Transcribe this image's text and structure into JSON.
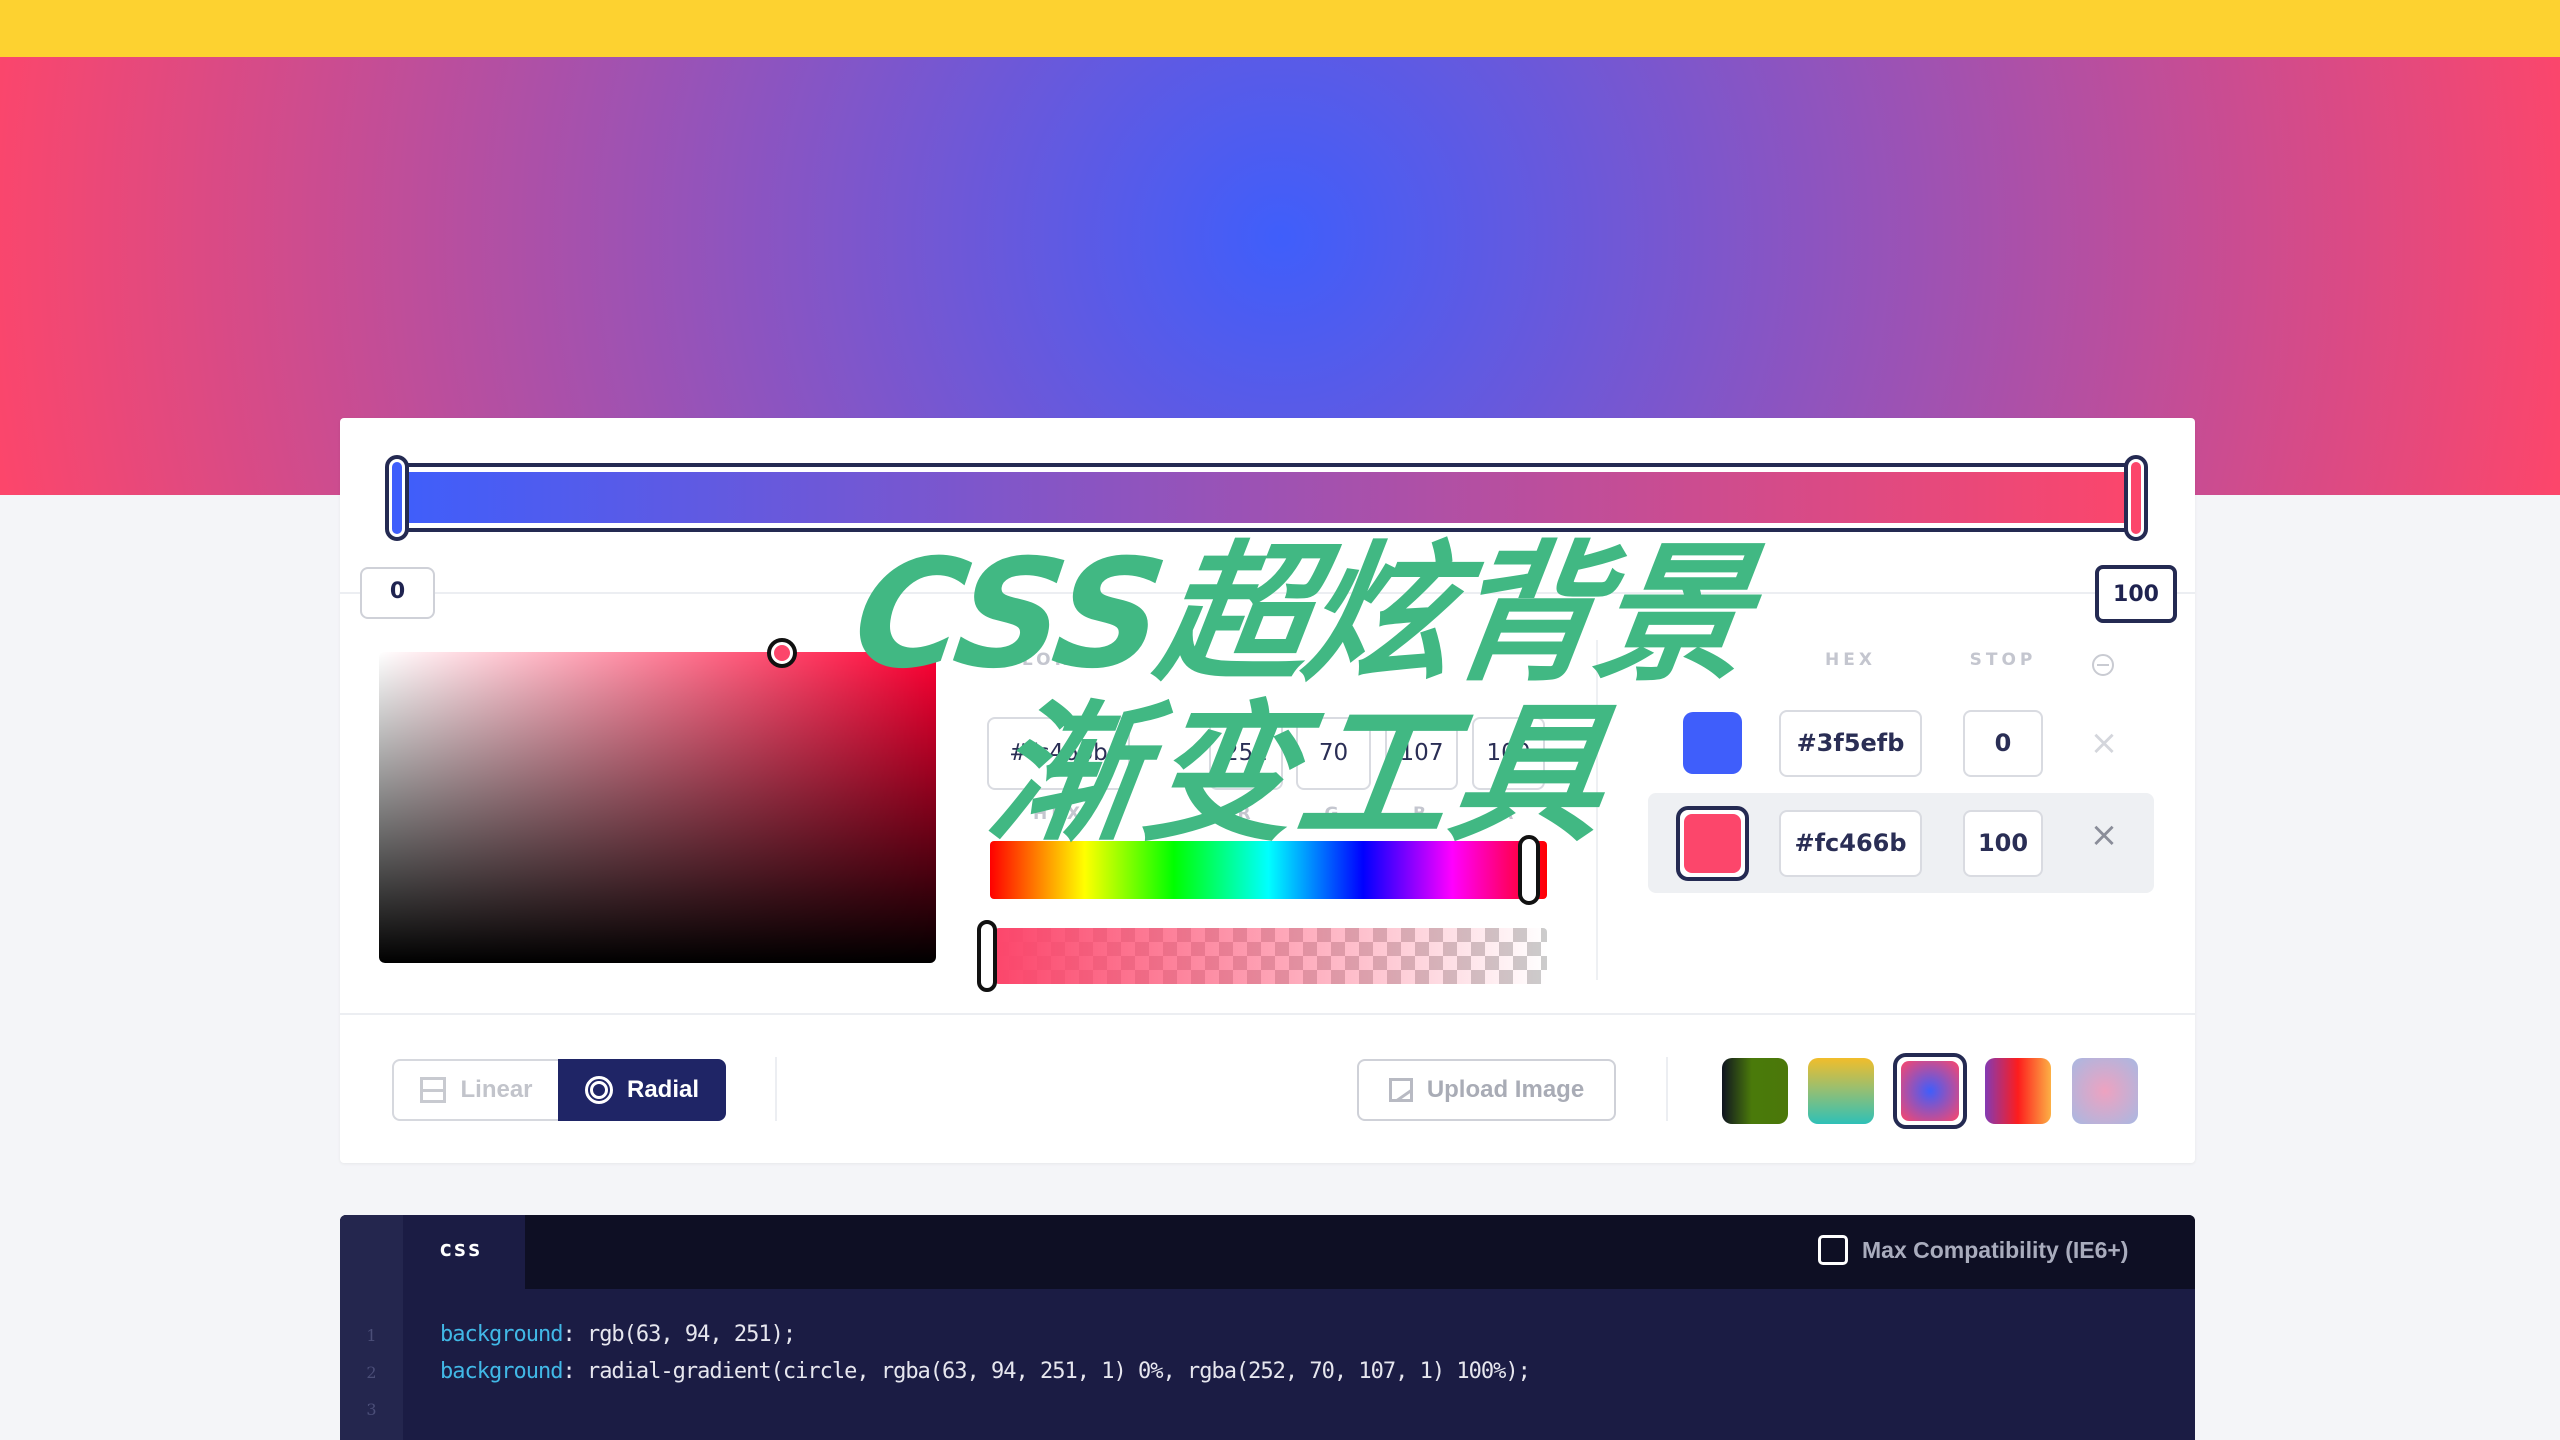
{
  "colors": {
    "start": "#3f5efb",
    "end": "#fc466b",
    "topbar": "#fdd230",
    "accent": "#1f2566"
  },
  "gradient": {
    "type": "radial",
    "stops": [
      {
        "hex": "#3f5efb",
        "stop": "0",
        "active": false
      },
      {
        "hex": "#fc466b",
        "stop": "100",
        "active": true
      }
    ],
    "slider_labels": {
      "left": "0",
      "right": "100"
    }
  },
  "picker": {
    "color_label": "COLOR",
    "hex_value": "#fc466b",
    "r": "252",
    "g": "70",
    "b": "107",
    "a": "100",
    "labels": {
      "hex": "HEX",
      "r": "R",
      "g": "G",
      "b": "B",
      "a": "A"
    },
    "hue_fraction": 0.97,
    "alpha_percent": 100
  },
  "stops_table": {
    "header_hex": "HEX",
    "header_stop": "STOP",
    "remove_symbol": "×"
  },
  "toolbar": {
    "linear_label": "Linear",
    "radial_label": "Radial",
    "selected": "Radial",
    "upload_label": "Upload Image",
    "presets": [
      {
        "name": "dark-green",
        "selected": false
      },
      {
        "name": "yellow-teal",
        "selected": false
      },
      {
        "name": "blue-pink-radial",
        "selected": true
      },
      {
        "name": "purple-red-orange",
        "selected": false
      },
      {
        "name": "pink-lavender-radial",
        "selected": false
      }
    ]
  },
  "code": {
    "tab_label": "css",
    "compat_label": "Max Compatibility (IE6+)",
    "compat_checked": false,
    "lines": [
      {
        "num": "1",
        "prop": "background",
        "value": ": rgb(63, 94, 251);"
      },
      {
        "num": "2",
        "prop": "background",
        "value": ": radial-gradient(circle, rgba(63, 94, 251, 1) 0%, rgba(252, 70, 107, 1) 100%);"
      },
      {
        "num": "3",
        "prop": "",
        "value": ""
      }
    ]
  },
  "overlay": {
    "line1": "CSS超炫背景",
    "line2": "渐变工具"
  }
}
